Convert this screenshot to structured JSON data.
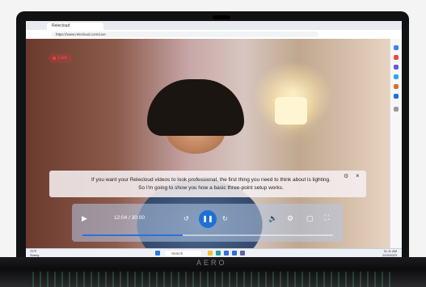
{
  "browser": {
    "tab_title": "Relecloud",
    "url": "https://www.relecloud.com/Live"
  },
  "video": {
    "live_badge": "Live",
    "caption": "If you want your Relecloud videos to look professional, the first thing you need to think about is lighting. So I'm going to show you how a basic three-point setup works.",
    "time": "12:04 / 30:00",
    "progress_fraction": 0.4
  },
  "taskbar": {
    "search_placeholder": "Search",
    "weather_temp": "72°F",
    "weather_desc": "Sunny",
    "clock_time": "11:11 AM",
    "clock_date": "2/10/2023"
  },
  "device": {
    "brand": "AERO"
  },
  "icons": {
    "play": "play-icon",
    "pause": "pause-icon",
    "rewind": "rewind-10-icon",
    "forward": "forward-10-icon",
    "volume": "volume-icon",
    "settings": "settings-icon",
    "miniplayer": "miniplayer-icon",
    "fullscreen": "fullscreen-icon"
  },
  "colors": {
    "accent": "#1f6fd6",
    "live_red": "#ff3b3b"
  }
}
